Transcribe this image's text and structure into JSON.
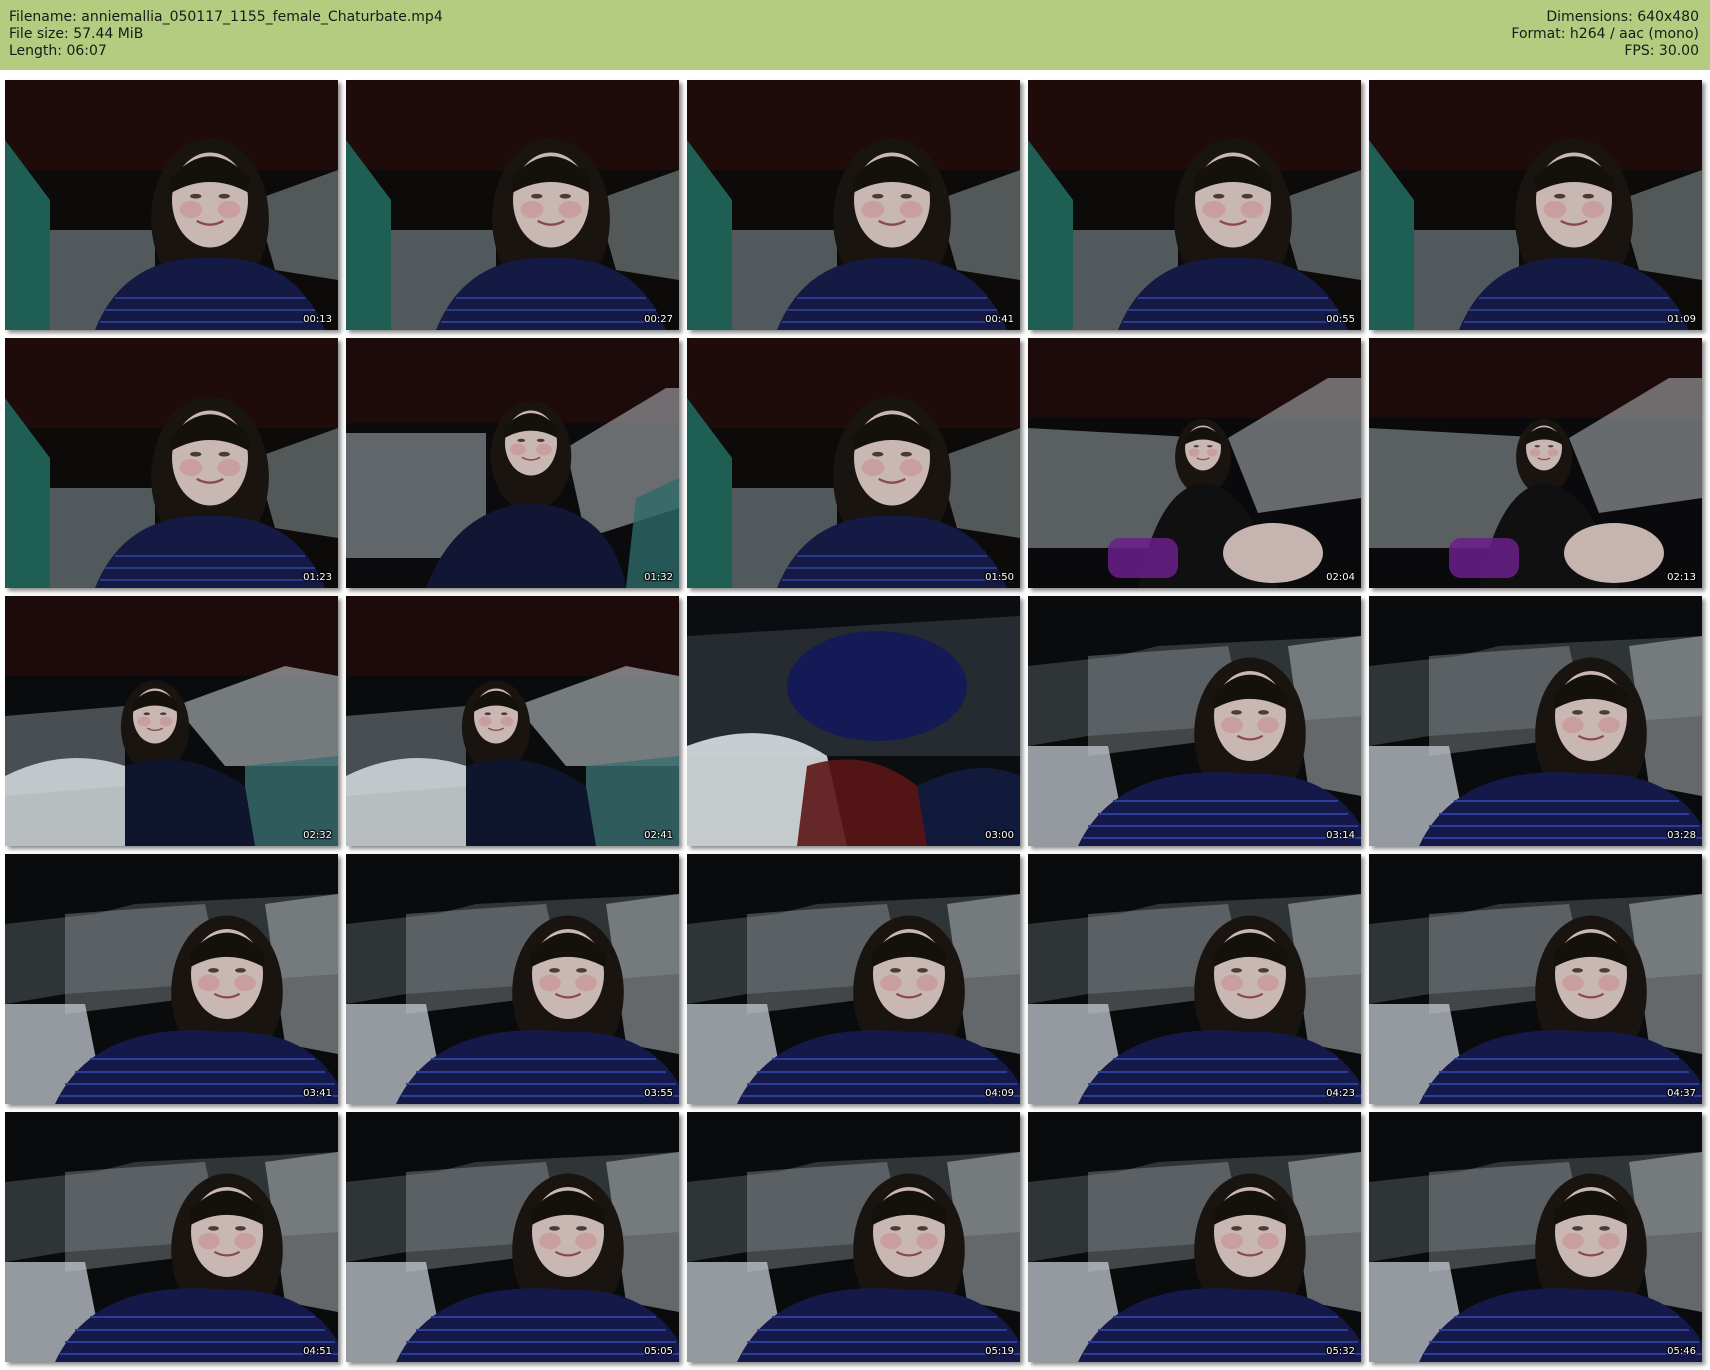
{
  "header": {
    "filename_line": "Filename: anniemallia_050117_1155_female_Chaturbate.mp4",
    "filesize_line": "File size: 57.44 MiB",
    "length_line": "Length: 06:07",
    "dimensions_line": "Dimensions: 640x480",
    "format_line": "Format: h264 / aac (mono)",
    "fps_line": "FPS: 30.00"
  },
  "colors": {
    "header_bg": "#b3cc80",
    "page_bg": "#ffffff"
  },
  "thumbnails": [
    {
      "timestamp": "00:13",
      "scene": "face-curtain"
    },
    {
      "timestamp": "00:27",
      "scene": "face-curtain"
    },
    {
      "timestamp": "00:41",
      "scene": "face-curtain"
    },
    {
      "timestamp": "00:55",
      "scene": "face-curtain"
    },
    {
      "timestamp": "01:09",
      "scene": "face-curtain"
    },
    {
      "timestamp": "01:23",
      "scene": "face-curtain"
    },
    {
      "timestamp": "01:32",
      "scene": "mid-room"
    },
    {
      "timestamp": "01:50",
      "scene": "face-curtain"
    },
    {
      "timestamp": "02:04",
      "scene": "far-room"
    },
    {
      "timestamp": "02:13",
      "scene": "far-room"
    },
    {
      "timestamp": "02:32",
      "scene": "lying-side"
    },
    {
      "timestamp": "02:41",
      "scene": "lying-side"
    },
    {
      "timestamp": "03:00",
      "scene": "blanket"
    },
    {
      "timestamp": "03:14",
      "scene": "face-pillow"
    },
    {
      "timestamp": "03:28",
      "scene": "face-pillow"
    },
    {
      "timestamp": "03:41",
      "scene": "face-pillow"
    },
    {
      "timestamp": "03:55",
      "scene": "face-pillow"
    },
    {
      "timestamp": "04:09",
      "scene": "face-pillow"
    },
    {
      "timestamp": "04:23",
      "scene": "face-pillow"
    },
    {
      "timestamp": "04:37",
      "scene": "face-pillow"
    },
    {
      "timestamp": "04:51",
      "scene": "face-pillow"
    },
    {
      "timestamp": "05:05",
      "scene": "face-pillow"
    },
    {
      "timestamp": "05:19",
      "scene": "face-pillow"
    },
    {
      "timestamp": "05:32",
      "scene": "face-pillow"
    },
    {
      "timestamp": "05:46",
      "scene": "face-pillow"
    }
  ]
}
